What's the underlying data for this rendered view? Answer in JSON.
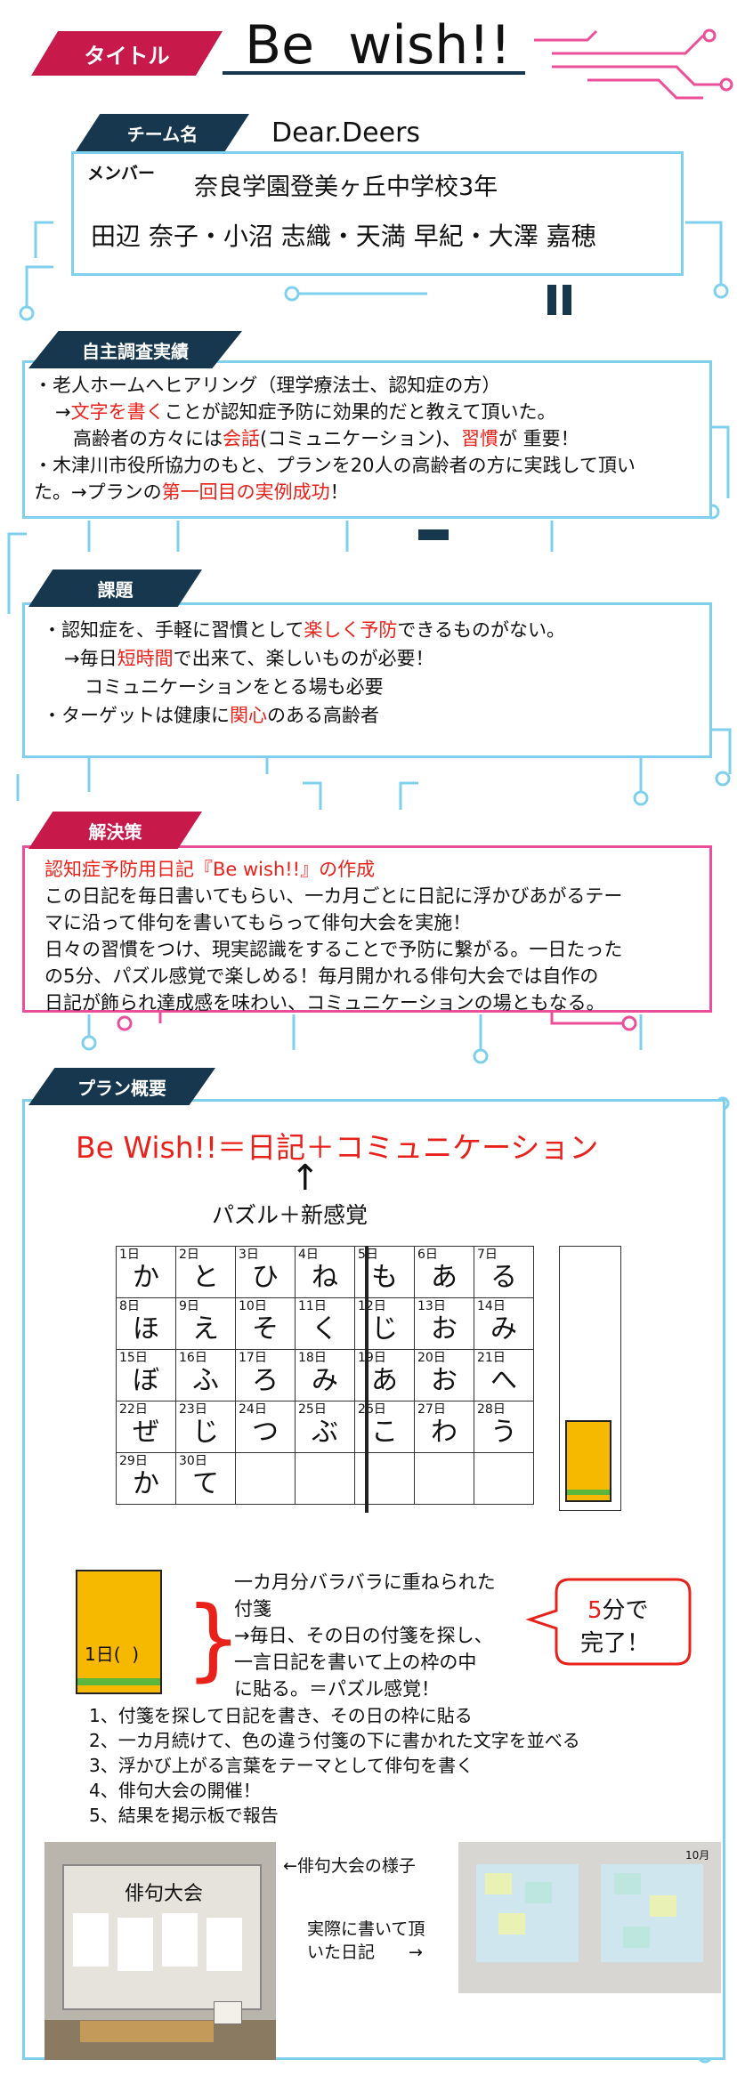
{
  "colors": {
    "accent_red": "#e8211a",
    "tag_navy": "#17374f",
    "tag_red": "#c8194b",
    "frame_blue": "#7fd0ec",
    "frame_pink": "#ec4f9a",
    "sticky_yellow": "#f7b800",
    "sticky_green": "#5bb63a"
  },
  "header": {
    "title_tag": "タイトル",
    "title": "Be  wish!!"
  },
  "team": {
    "tag": "チーム名",
    "name": "Dear.Deers",
    "member_label": "メンバー",
    "school": "奈良学園登美ヶ丘中学校3年",
    "members": "田辺 奈子・小沼 志織・天満 早紀・大澤 嘉穂"
  },
  "research": {
    "tag": "自主調査実績",
    "l1": "・老人ホームへヒアリング（理学療法士、認知症の方）",
    "l2a": "→",
    "l2b": "文字を書く",
    "l2c": "ことが認知症予防に効果的だと教えて頂いた。",
    "l3a": "高齢者の方々には",
    "l3b": "会話",
    "l3c": "(コミュニケーション)、",
    "l3d": "習慣",
    "l3e": "が 重要！",
    "l4": "・木津川市役所協力のもと、プランを20人の高齢者の方に実践して頂い",
    "l5a": "た。→プランの",
    "l5b": "第一回目の実例成功",
    "l5c": "！"
  },
  "issue": {
    "tag": "課題",
    "l1a": "・認知症を、手軽に習慣として",
    "l1b": "楽しく予防",
    "l1c": "できるものがない。",
    "l2a": "→毎日",
    "l2b": "短時間",
    "l2c": "で出来て、楽しいものが必要！",
    "l3": "コミュニケーションをとる場も必要",
    "l4a": "・ターゲットは健康に",
    "l4b": "関心",
    "l4c": "のある高齢者"
  },
  "solution": {
    "tag": "解決策",
    "l1": "認知症予防用日記『Be  wish!!』の作成",
    "l2": "この日記を毎日書いてもらい、一カ月ごとに日記に浮かびあがるテー",
    "l3": "マに沿って俳句を書いてもらって俳句大会を実施！",
    "l4": "日々の習慣をつけ、現実認識をすることで予防に繋がる。一日たった",
    "l5": "の5分、パズル感覚で楽しめる！毎月開かれる俳句大会では自作の",
    "l6": "日記が飾られ達成感を味わい、コミュニケーションの場ともなる。"
  },
  "plan": {
    "tag": "プラン概要",
    "formula": "Be Wish!!＝日記＋コミュニケーション",
    "arrow": "↑",
    "puzzle": "パズル＋新感覚",
    "calendar": [
      [
        [
          "1日",
          "か"
        ],
        [
          "2日",
          "と"
        ],
        [
          "3日",
          "ひ"
        ],
        [
          "4日",
          "ね"
        ],
        [
          "5日",
          "も"
        ],
        [
          "6日",
          "あ"
        ],
        [
          "7日",
          "る"
        ]
      ],
      [
        [
          "8日",
          "ほ"
        ],
        [
          "9日",
          "え"
        ],
        [
          "10日",
          "そ"
        ],
        [
          "11日",
          "く"
        ],
        [
          "12日",
          "じ"
        ],
        [
          "13日",
          "お"
        ],
        [
          "14日",
          "み"
        ]
      ],
      [
        [
          "15日",
          "ぼ"
        ],
        [
          "16日",
          "ふ"
        ],
        [
          "17日",
          "ろ"
        ],
        [
          "18日",
          "み"
        ],
        [
          "19日",
          "あ"
        ],
        [
          "20日",
          "お"
        ],
        [
          "21日",
          "へ"
        ]
      ],
      [
        [
          "22日",
          "ぜ"
        ],
        [
          "23日",
          "じ"
        ],
        [
          "24日",
          "つ"
        ],
        [
          "25日",
          "ぶ"
        ],
        [
          "26日",
          "こ"
        ],
        [
          "27日",
          "わ"
        ],
        [
          "28日",
          "う"
        ]
      ],
      [
        [
          "29日",
          "か"
        ],
        [
          "30日",
          "て"
        ],
        [
          "",
          ""
        ],
        [
          "",
          ""
        ],
        [
          "",
          ""
        ],
        [
          "",
          ""
        ],
        [
          "",
          ""
        ]
      ]
    ],
    "sticky_label": "1日(  )",
    "desc1": "一カ月分バラバラに重ねられた",
    "desc2": "付箋",
    "desc3": "→毎日、その日の付箋を探し、",
    "desc4": "一言日記を書いて上の枠の中",
    "desc5": "に貼る。＝パズル感覚！",
    "bubble_num": "5",
    "bubble_a": "分で",
    "bubble_b": "完了！",
    "steps": [
      "1、付箋を探して日記を書き、その日の枠に貼る",
      "2、一カ月続けて、色の違う付箋の下に書かれた文字を並べる",
      "3、浮かび上がる言葉をテーマとして俳句を書く",
      "4、俳句大会の開催！",
      "5、結果を掲示板で報告"
    ],
    "photo1_caption": "←俳句大会の様子",
    "photo1_sign": "俳句大会",
    "photo2_caption_1": "実際に書いて頂",
    "photo2_caption_2": "いた日記　　→",
    "photo2_month": "10月"
  }
}
